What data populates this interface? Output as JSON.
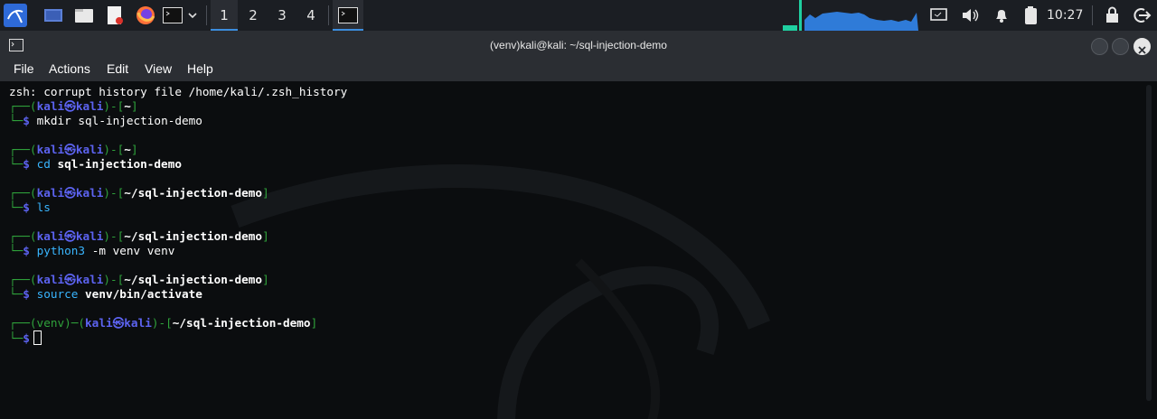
{
  "taskbar": {
    "workspaces": [
      "1",
      "2",
      "3",
      "4"
    ],
    "clock": "10:27",
    "icons": [
      "kali-menu-icon",
      "desktop-icon",
      "file-manager-icon",
      "text-editor-icon",
      "firefox-icon",
      "terminal-icon",
      "chevron-down-icon",
      "task-terminal-icon",
      "cpu-graph",
      "display-icon",
      "volume-icon",
      "notification-bell-icon",
      "battery-icon",
      "lock-icon",
      "logout-icon"
    ]
  },
  "window": {
    "title": "(venv)kali@kali: ~/sql-injection-demo",
    "menu": [
      "File",
      "Actions",
      "Edit",
      "View",
      "Help"
    ]
  },
  "terminal": {
    "notice": "zsh: corrupt history file /home/kali/.zsh_history",
    "user": "kali",
    "host": "kali",
    "at_symbol": "㉿",
    "venv_label": "(venv)",
    "prompt_symbol": "$",
    "entries": [
      {
        "path": "~",
        "cmd": "mkdir",
        "args": "sql-injection-demo"
      },
      {
        "path": "~",
        "cmd": "cd",
        "args": "sql-injection-demo"
      },
      {
        "path": "~/sql-injection-demo",
        "cmd": "ls",
        "args": ""
      },
      {
        "path": "~/sql-injection-demo",
        "cmd": "python3",
        "args": "-m venv venv"
      },
      {
        "path": "~/sql-injection-demo",
        "cmd": "source",
        "args": "venv/bin/activate"
      }
    ],
    "current_path": "~/sql-injection-demo"
  },
  "colors": {
    "prompt_frame": "#2fa23b",
    "user_host": "#5c63f0",
    "command": "#39b5ff",
    "taskbar_bg": "#1b1e23",
    "accent": "#3c8dde"
  }
}
